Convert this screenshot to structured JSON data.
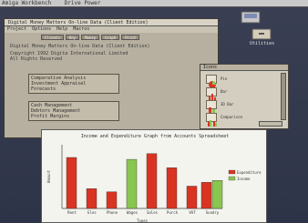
{
  "workbench": {
    "title_left": "Amiga Workbench",
    "title_right": "Drive Power"
  },
  "desktop_icons": [
    {
      "name": "ram-disk-icon",
      "label": ""
    },
    {
      "name": "drawer-icon",
      "label": "Utilities"
    }
  ],
  "app": {
    "title": "Digital Money Matters On-line Data (Client Edition)",
    "menu_items": [
      "Project",
      "Options",
      "Help",
      "Macros"
    ],
    "tabs": [
      "Clients",
      "Key",
      "Money",
      "Graph",
      "Print"
    ],
    "heading": "Digital Money Matters On-line Data (Client Edition)",
    "copyright_line1": "Copyright 1992 Digita International Limited",
    "copyright_line2": "All Rights Reserved",
    "group1": [
      "Comparative Analysis",
      "Investment Appraisal",
      "Forecasts"
    ],
    "group2": [
      "Cash Management",
      "Debtors Management",
      "Profit Margins"
    ]
  },
  "icons_window": {
    "title": "Icons",
    "items": [
      {
        "label": "Pie",
        "icon": "pie-chart-icon"
      },
      {
        "label": "Bar",
        "icon": "bar-chart-icon"
      },
      {
        "label": "3D Bar",
        "icon": "3d-bar-chart-icon"
      },
      {
        "label": "Comparison",
        "icon": "comparison-chart-icon"
      }
    ]
  },
  "colors": {
    "income": "#d93422",
    "expenditure": "#89c650",
    "desktop": "#343a4e",
    "window": "#b7b0a0"
  },
  "chart_data": {
    "type": "bar",
    "title": "Income and Expenditure Graph from Accounts Spreadsheet",
    "xlabel": "Types",
    "ylabel": "Amount",
    "categories": [
      "Rent",
      "Elec",
      "Phone",
      "Wages",
      "Sales",
      "Purch",
      "VAT",
      "Sundry"
    ],
    "series": [
      {
        "name": "Expenditure",
        "values": [
          8.0,
          3.1,
          2.6,
          0,
          8.6,
          6.4,
          3.5,
          4.1
        ]
      },
      {
        "name": "Income",
        "values": [
          0,
          0,
          0,
          7.7,
          0,
          0,
          0,
          4.4
        ]
      }
    ],
    "ylim": [
      0,
      10
    ],
    "legend": "right",
    "grid": false
  }
}
